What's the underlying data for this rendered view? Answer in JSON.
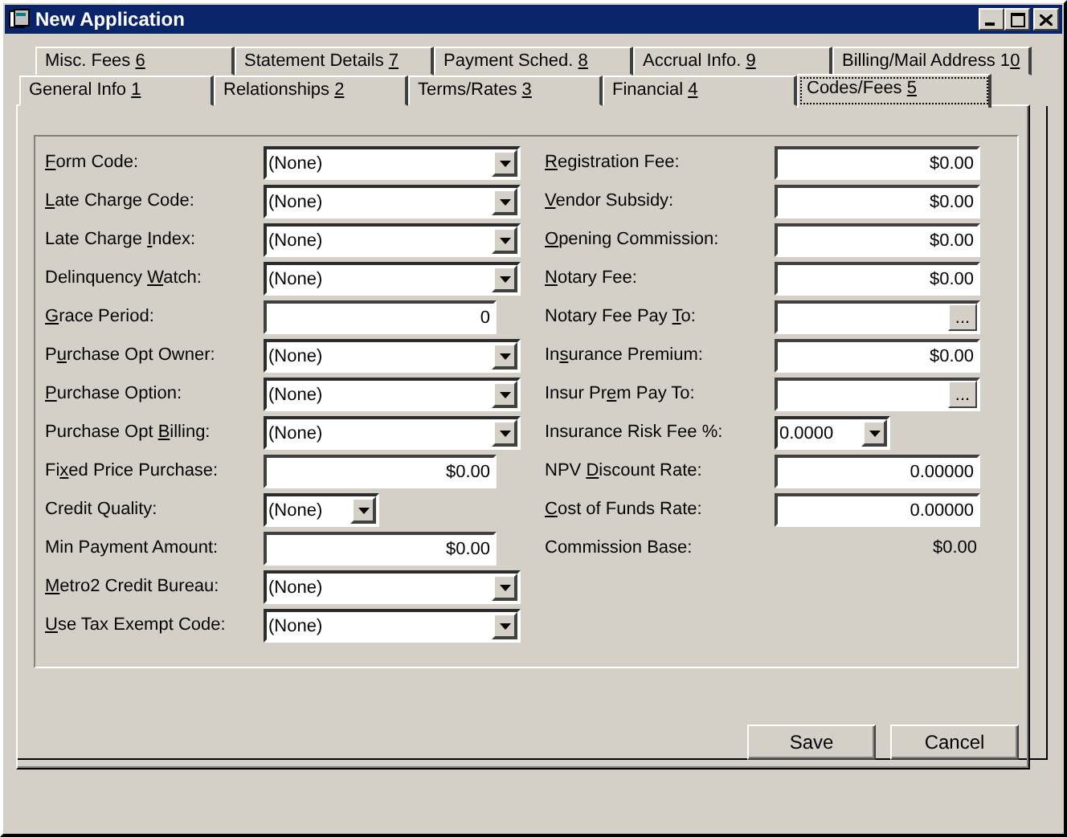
{
  "window": {
    "title": "New Application"
  },
  "tabs_back": [
    {
      "label": {
        "before": "Misc. Fees ",
        "key": "6"
      },
      "selected": false
    },
    {
      "label": {
        "before": "Statement Details ",
        "key": "7"
      },
      "selected": false
    },
    {
      "label": {
        "before": "Payment Sched. ",
        "key": "8"
      },
      "selected": false
    },
    {
      "label": {
        "before": "Accrual Info. ",
        "key": "9"
      },
      "selected": false
    },
    {
      "label": {
        "before": "Billing/Mail Address 1",
        "key": "0"
      },
      "selected": false
    }
  ],
  "tabs_front": [
    {
      "label": {
        "before": "General Info ",
        "key": "1"
      },
      "selected": false
    },
    {
      "label": {
        "before": "Relationships ",
        "key": "2"
      },
      "selected": false
    },
    {
      "label": {
        "before": "Terms/Rates ",
        "key": "3"
      },
      "selected": false
    },
    {
      "label": {
        "before": "Financial ",
        "key": "4"
      },
      "selected": false
    },
    {
      "label": {
        "before": "Codes/Fees ",
        "key": "5"
      },
      "selected": true
    }
  ],
  "left_fields": [
    {
      "label": {
        "key": "F",
        "after": "orm Code:"
      },
      "kind": "combo",
      "value": "(None)"
    },
    {
      "label": {
        "key": "L",
        "after": "ate Charge Code:"
      },
      "kind": "combo",
      "value": "(None)"
    },
    {
      "label": {
        "before": "Late Charge ",
        "key": "I",
        "after": "ndex:"
      },
      "kind": "combo",
      "value": "(None)"
    },
    {
      "label": {
        "before": "Delinquency ",
        "key": "W",
        "after": "atch:"
      },
      "kind": "combo",
      "value": "(None)"
    },
    {
      "label": {
        "key": "G",
        "after": "race Period:"
      },
      "kind": "text",
      "value": "0"
    },
    {
      "label": {
        "before": "P",
        "key": "u",
        "after": "rchase Opt Owner:"
      },
      "kind": "combo",
      "value": "(None)"
    },
    {
      "label": {
        "key": "P",
        "after": "urchase Option:"
      },
      "kind": "combo",
      "value": "(None)"
    },
    {
      "label": {
        "before": "Purchase Opt ",
        "key": "B",
        "after": "illing:"
      },
      "kind": "combo",
      "value": "(None)"
    },
    {
      "label": {
        "before": "Fi",
        "key": "x",
        "after": "ed Price Purchase:"
      },
      "kind": "text",
      "value": "$0.00"
    },
    {
      "label": {
        "before": "Credit Quality:"
      },
      "kind": "small-combo",
      "value": "(None)"
    },
    {
      "label": {
        "before": "Min Payment Amount:"
      },
      "kind": "text",
      "value": "$0.00"
    },
    {
      "label": {
        "key": "M",
        "after": "etro2 Credit Bureau:"
      },
      "kind": "combo",
      "value": "(None)"
    },
    {
      "label": {
        "key": "U",
        "after": "se Tax Exempt Code:"
      },
      "kind": "combo",
      "value": "(None)"
    }
  ],
  "right_fields": [
    {
      "label": {
        "key": "R",
        "after": "egistration Fee:"
      },
      "kind": "text",
      "value": "$0.00"
    },
    {
      "label": {
        "key": "V",
        "after": "endor Subsidy:"
      },
      "kind": "text",
      "value": "$0.00"
    },
    {
      "label": {
        "key": "O",
        "after": "pening Commission:"
      },
      "kind": "text",
      "value": "$0.00"
    },
    {
      "label": {
        "key": "N",
        "after": "otary Fee:"
      },
      "kind": "text",
      "value": "$0.00"
    },
    {
      "label": {
        "before": "Notary Fee Pay ",
        "key": "T",
        "after": "o:"
      },
      "kind": "lookup",
      "button": "..."
    },
    {
      "label": {
        "before": "In",
        "key": "s",
        "after": "urance Premium:"
      },
      "kind": "text",
      "value": "$0.00"
    },
    {
      "label": {
        "before": "Insur Pr",
        "key": "e",
        "after": "m Pay To:"
      },
      "kind": "lookup",
      "button": "..."
    },
    {
      "label": {
        "before": "Insurance Risk Fee %:"
      },
      "kind": "small-combo",
      "value": "0.0000"
    },
    {
      "label": {
        "before": "NPV ",
        "key": "D",
        "after": "iscount Rate:"
      },
      "kind": "text",
      "value": "0.00000"
    },
    {
      "label": {
        "key": "C",
        "after": "ost of Funds Rate:"
      },
      "kind": "text",
      "value": "0.00000"
    },
    {
      "label": {
        "before": "Commission Base:"
      },
      "kind": "readout",
      "value": "$0.00"
    }
  ],
  "buttons": [
    "Save",
    "Cancel"
  ]
}
